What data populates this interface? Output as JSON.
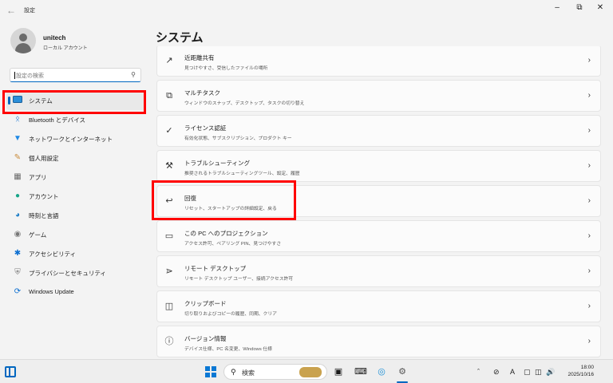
{
  "window": {
    "title": "設定"
  },
  "user": {
    "name": "unitech",
    "account": "ローカル アカウント"
  },
  "search": {
    "placeholder": "設定の検索"
  },
  "sidebar": {
    "items": [
      {
        "label": "システム",
        "icon": "system-icon"
      },
      {
        "label": "Bluetooth とデバイス",
        "icon": "bluetooth-icon"
      },
      {
        "label": "ネットワークとインターネット",
        "icon": "wifi-icon"
      },
      {
        "label": "個人用設定",
        "icon": "brush-icon"
      },
      {
        "label": "アプリ",
        "icon": "apps-icon"
      },
      {
        "label": "アカウント",
        "icon": "person-icon"
      },
      {
        "label": "時刻と言語",
        "icon": "globe-icon"
      },
      {
        "label": "ゲーム",
        "icon": "gamepad-icon"
      },
      {
        "label": "アクセシビリティ",
        "icon": "accessibility-icon"
      },
      {
        "label": "プライバシーとセキュリティ",
        "icon": "shield-icon"
      },
      {
        "label": "Windows Update",
        "icon": "update-icon"
      }
    ]
  },
  "main": {
    "title": "システム",
    "cards": [
      {
        "title": "近距離共有",
        "subtitle": "見つけやすさ、受信したファイルの場所"
      },
      {
        "title": "マルチタスク",
        "subtitle": "ウィンドウのスナップ、デスクトップ、タスクの切り替え"
      },
      {
        "title": "ライセンス認証",
        "subtitle": "有効化状態、サブスクリプション、プロダクト キー"
      },
      {
        "title": "トラブルシューティング",
        "subtitle": "推奨されるトラブルシューティングツール、設定、履歴"
      },
      {
        "title": "回復",
        "subtitle": "リセット、スタートアップの詳細設定、戻る"
      },
      {
        "title": "この PC へのプロジェクション",
        "subtitle": "アクセス許可、ペアリング PIN、見つけやすさ"
      },
      {
        "title": "リモート デスクトップ",
        "subtitle": "リモート デスクトップ ユーザー、接続アクセス許可"
      },
      {
        "title": "クリップボード",
        "subtitle": "切り取りおよびコピーの履歴、同期、クリア"
      },
      {
        "title": "バージョン情報",
        "subtitle": "デバイス仕様、PC 名変更、Windows 仕様"
      }
    ]
  },
  "taskbar": {
    "search_label": "検索",
    "time": "18:00",
    "date": "2025/10/16",
    "ime": "A"
  },
  "colors": {
    "accent": "#0067c0",
    "highlight_box": "#ff0000"
  }
}
